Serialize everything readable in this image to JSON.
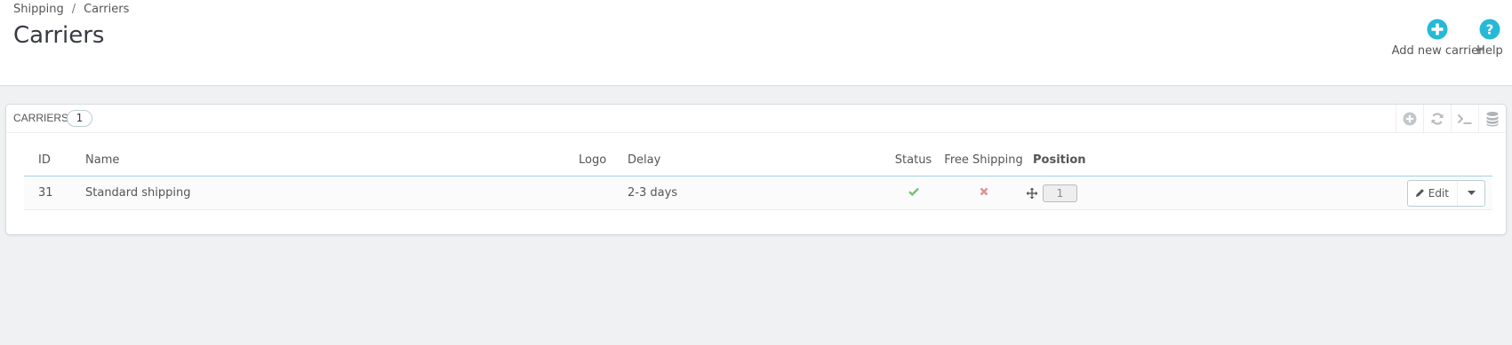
{
  "breadcrumb": {
    "parent": "Shipping",
    "separator": "/",
    "current": "Carriers"
  },
  "page_title": "Carriers",
  "toolbar": {
    "add_label": "Add new carrier",
    "help_label": "Help"
  },
  "colors": {
    "accent": "#25b9d7",
    "success": "#72c279",
    "danger": "#e08f95"
  },
  "panel": {
    "title": "Carriers",
    "count": "1",
    "actions": [
      "add-icon",
      "refresh-icon",
      "sql-terminal-icon",
      "database-export-icon"
    ]
  },
  "table": {
    "headers": {
      "id": "ID",
      "name": "Name",
      "logo": "Logo",
      "delay": "Delay",
      "status": "Status",
      "free_shipping": "Free Shipping",
      "position": "Position"
    },
    "rows": [
      {
        "id": "31",
        "name": "Standard shipping",
        "logo": "",
        "delay": "2-3 days",
        "status": "enabled",
        "free_shipping": "no",
        "position": "1",
        "edit_label": "Edit"
      }
    ]
  }
}
